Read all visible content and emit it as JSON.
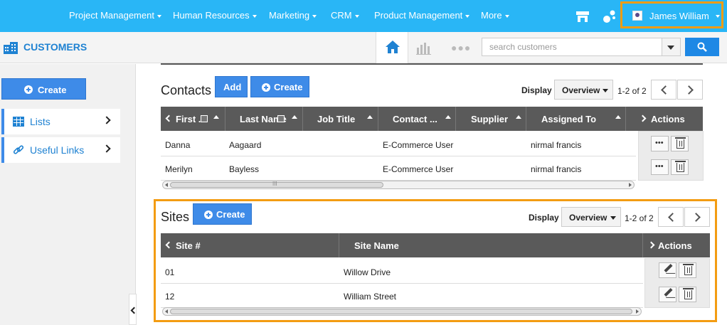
{
  "nav": {
    "items": [
      "Project Management",
      "Human Resources",
      "Marketing",
      "CRM",
      "Product Management",
      "More"
    ],
    "user_name": "James William",
    "accent": "#29b6f6",
    "highlight": "#f39c12"
  },
  "header": {
    "app_title": "CUSTOMERS",
    "search_placeholder": "search customers",
    "icons": [
      "home-icon",
      "chart-icon",
      "more-dots-icon",
      "search-icon"
    ]
  },
  "sidebar": {
    "create_label": "Create",
    "items": [
      {
        "label": "Lists",
        "icon": "list-icon"
      },
      {
        "label": "Useful Links",
        "icon": "link-icon"
      }
    ]
  },
  "contacts": {
    "title": "Contacts",
    "add_label": "Add",
    "create_label": "Create",
    "display_label": "Display",
    "display_value": "Overview",
    "pager": "1-2 of 2",
    "columns": [
      "First ...",
      "Last Name",
      "Job Title",
      "Contact ...",
      "Supplier",
      "Assigned To",
      "Actions"
    ],
    "rows": [
      {
        "first": "Danna",
        "last": "Aagaard",
        "job": "",
        "contact": "E-Commerce User",
        "supplier": "",
        "assigned": "nirmal francis"
      },
      {
        "first": "Merilyn",
        "last": "Bayless",
        "job": "",
        "contact": "E-Commerce User",
        "supplier": "",
        "assigned": "nirmal francis"
      }
    ],
    "scroll_marker": "III"
  },
  "sites": {
    "title": "Sites",
    "create_label": "Create",
    "display_label": "Display",
    "display_value": "Overview",
    "pager": "1-2 of 2",
    "columns": [
      "Site #",
      "Site Name",
      "Actions"
    ],
    "rows": [
      {
        "num": "01",
        "name": "Willow Drive"
      },
      {
        "num": "12",
        "name": "William Street"
      }
    ]
  }
}
